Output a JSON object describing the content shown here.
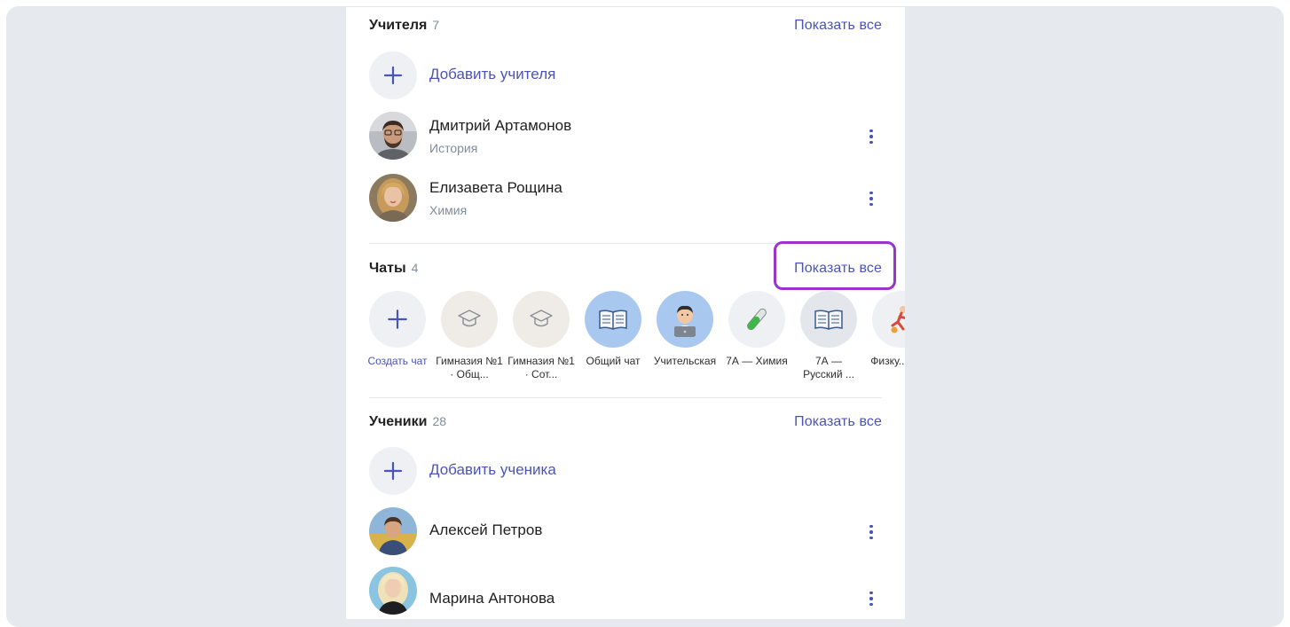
{
  "teachers": {
    "title": "Учителя",
    "count": "7",
    "show_all": "Показать все",
    "add_label": "Добавить учителя",
    "items": [
      {
        "name": "Дмитрий Артамонов",
        "subject": "История"
      },
      {
        "name": "Елизавета Рощина",
        "subject": "Химия"
      }
    ]
  },
  "chats": {
    "title": "Чаты",
    "count": "4",
    "show_all": "Показать все",
    "items": [
      {
        "label": "Создать чат",
        "icon": "plus-icon"
      },
      {
        "label": "Гимназия №1 · Общ...",
        "icon": "graduation-cap-icon"
      },
      {
        "label": "Гимназия №1 · Сот...",
        "icon": "graduation-cap-icon"
      },
      {
        "label": "Общий чат",
        "icon": "book-icon"
      },
      {
        "label": "Учительская",
        "icon": "teacher-laptop-icon"
      },
      {
        "label": "7А — Химия",
        "icon": "test-tube-icon"
      },
      {
        "label": "7А — Русский ...",
        "icon": "book-icon"
      },
      {
        "label": "Физку... ур...",
        "icon": "sport-icon"
      }
    ]
  },
  "students": {
    "title": "Ученики",
    "count": "28",
    "show_all": "Показать все",
    "add_label": "Добавить ученика",
    "items": [
      {
        "name": "Алексей Петров"
      },
      {
        "name": "Марина Антонова"
      }
    ]
  },
  "colors": {
    "accent": "#4a54b4",
    "highlight": "#9b35c9",
    "background": "#e6e9ed"
  }
}
